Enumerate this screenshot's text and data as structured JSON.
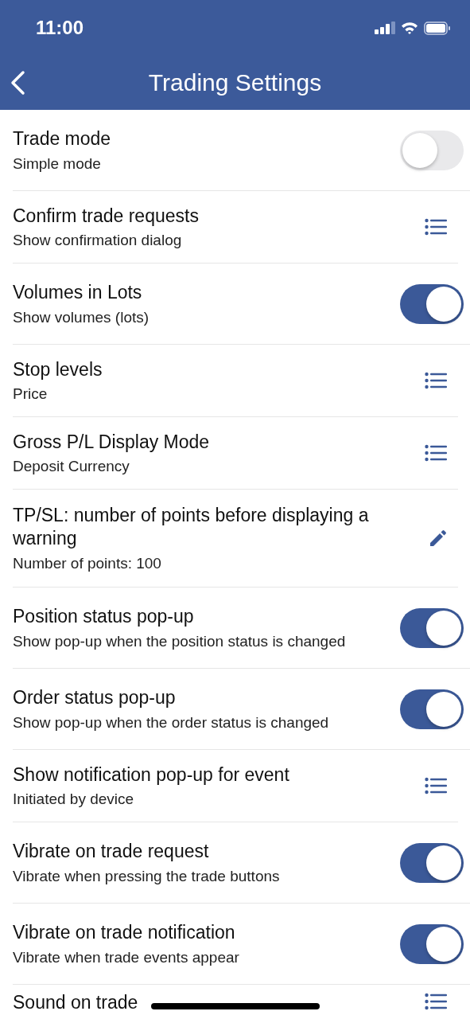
{
  "status_bar": {
    "time": "11:00"
  },
  "header": {
    "title": "Trading Settings"
  },
  "settings": [
    {
      "kind": "toggle",
      "title": "Trade mode",
      "subtitle": "Simple mode",
      "on": false
    },
    {
      "kind": "list",
      "title": "Confirm trade requests",
      "subtitle": "Show confirmation dialog"
    },
    {
      "kind": "toggle",
      "title": "Volumes in Lots",
      "subtitle": "Show volumes (lots)",
      "on": true
    },
    {
      "kind": "list",
      "title": "Stop levels",
      "subtitle": "Price"
    },
    {
      "kind": "list",
      "title": "Gross P/L Display Mode",
      "subtitle": "Deposit Currency"
    },
    {
      "kind": "edit",
      "title": "TP/SL: number of points before displaying a warning",
      "subtitle": "Number of points: 100"
    },
    {
      "kind": "toggle",
      "title": "Position status pop-up",
      "subtitle": "Show pop-up when the position status is changed",
      "on": true
    },
    {
      "kind": "toggle",
      "title": "Order status pop-up",
      "subtitle": "Show pop-up when the order status is changed",
      "on": true
    },
    {
      "kind": "list",
      "title": "Show notification pop-up for event",
      "subtitle": "Initiated by device"
    },
    {
      "kind": "toggle",
      "title": "Vibrate on trade request",
      "subtitle": "Vibrate when pressing the trade buttons",
      "on": true
    },
    {
      "kind": "toggle",
      "title": "Vibrate on trade notification",
      "subtitle": "Vibrate when trade events appear",
      "on": true
    },
    {
      "kind": "list",
      "title": "Sound on trade"
    }
  ]
}
